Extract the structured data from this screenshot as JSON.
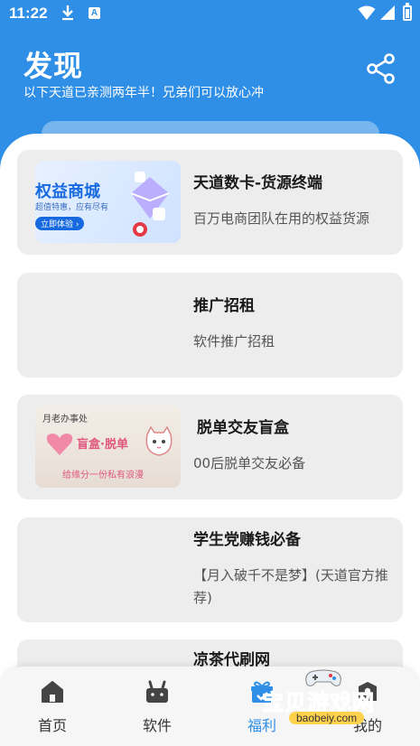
{
  "status_bar": {
    "time": "11:22",
    "a_badge": "A"
  },
  "header": {
    "title": "发现",
    "subtitle": "以下天道已亲测两年半！兄弟们可以放心冲"
  },
  "cards": [
    {
      "title": "天道数卡-货源终端",
      "desc": "百万电商团队在用的权益货源",
      "thumb_text": "权益商城",
      "thumb_sub": "超值特惠，应有尽有",
      "thumb_btn": "立即体验 ›"
    },
    {
      "title": "推广招租",
      "desc": "软件推广招租"
    },
    {
      "title": "脱单交友盲盒",
      "desc": "00后脱单交友必备",
      "thumb_text": "盲盒·脱单",
      "thumb_top": "月老办事处",
      "thumb_bottom": "给缘分一份私有浪漫"
    },
    {
      "title": "学生党赚钱必备",
      "desc": "【月入破千不是梦】(天道官方推荐)"
    },
    {
      "title": "凉茶代刷网",
      "desc": ""
    }
  ],
  "bottom_nav": [
    {
      "label": "首页",
      "active": false
    },
    {
      "label": "软件",
      "active": false
    },
    {
      "label": "福利",
      "active": true
    },
    {
      "label": "我的",
      "active": false
    }
  ],
  "watermark": {
    "text": "宝贝游戏网",
    "url": "baobeiy.com"
  },
  "colors": {
    "primary": "#2f8ee6",
    "card_bg": "#ededed",
    "text": "#1a1a1a",
    "muted": "#555555"
  }
}
